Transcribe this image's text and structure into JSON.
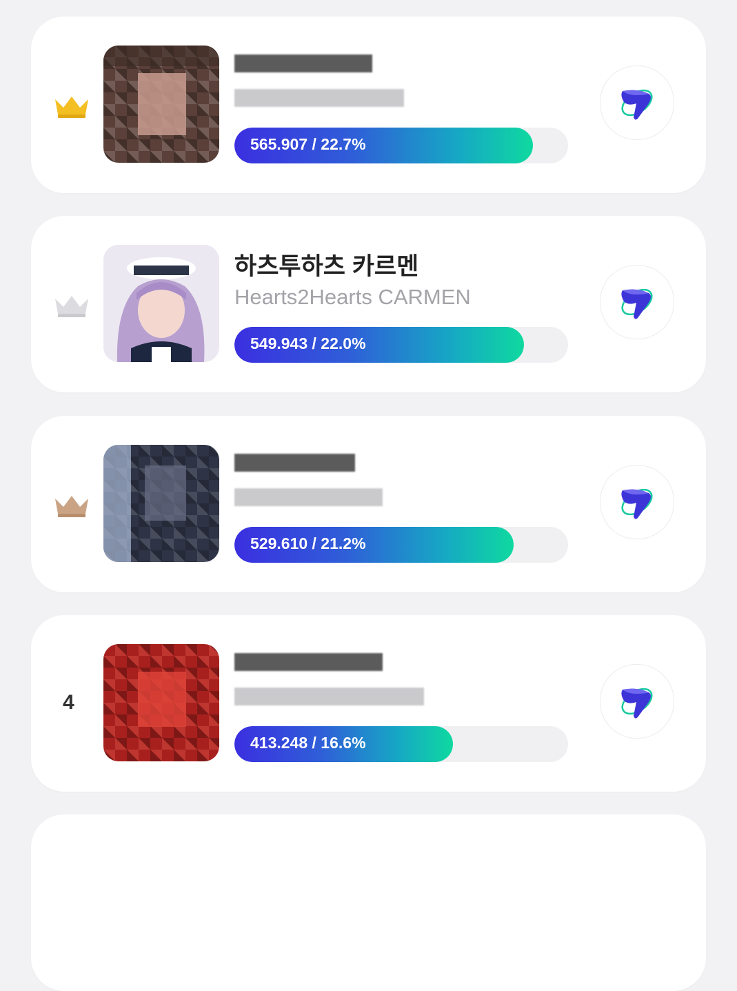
{
  "ranking": [
    {
      "rank": "1",
      "rank_icon": "gold-crown-icon",
      "crown_color": "#f3bf22",
      "name": "",
      "subtitle": "",
      "votes": "565.907",
      "share": "22.7%",
      "label": "565.907 / 22.7%",
      "share_value": 22.7,
      "avatar": "pixelated-photo",
      "vote_icon": "vote-logo-icon"
    },
    {
      "rank": "2",
      "rank_icon": "silver-crown-icon",
      "crown_color": "#d8d8dc",
      "name": "하츠투하츠 카르멘",
      "subtitle": "Hearts2Hearts CARMEN",
      "votes": "549.943",
      "share": "22.0%",
      "label": "549.943 / 22.0%",
      "share_value": 22.0,
      "avatar": "idol-photo",
      "vote_icon": "vote-logo-icon"
    },
    {
      "rank": "3",
      "rank_icon": "bronze-crown-icon",
      "crown_color": "#caa384",
      "name": "",
      "subtitle": "",
      "votes": "529.610",
      "share": "21.2%",
      "label": "529.610 / 21.2%",
      "share_value": 21.2,
      "avatar": "pixelated-photo",
      "vote_icon": "vote-logo-icon"
    },
    {
      "rank": "4",
      "rank_icon": "",
      "rank_text": "4",
      "name": "",
      "subtitle": "",
      "votes": "413.248",
      "share": "16.6%",
      "label": "413.248 / 16.6%",
      "share_value": 16.6,
      "avatar": "pixelated-photo",
      "vote_icon": "vote-logo-icon"
    }
  ],
  "colors": {
    "bar_start": "#3b2fe0",
    "bar_end": "#0fd9a0",
    "track": "#f0f0f2",
    "background": "#f2f2f4"
  }
}
